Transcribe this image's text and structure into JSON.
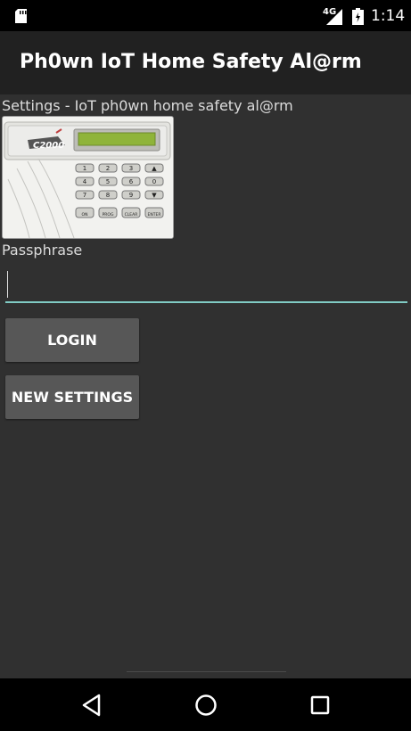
{
  "status_bar": {
    "network": "4G",
    "time": "1:14",
    "icons": [
      "sd-card-icon",
      "signal-icon",
      "battery-icon"
    ]
  },
  "app_bar": {
    "title": "Ph0wn IoT Home Safety Al@rm"
  },
  "main": {
    "settings_text": "Settings - IoT ph0wn home safety al@rm",
    "keypad": {
      "brand": "C2000",
      "keys": [
        "1",
        "2",
        "3",
        "▲",
        "4",
        "5",
        "6",
        "0",
        "7",
        "8",
        "9",
        "▼",
        "ON",
        "PROG",
        "CLEAR",
        "ENTER"
      ]
    },
    "passphrase_label": "Passphrase",
    "passphrase_value": "",
    "login_button": "LOGIN",
    "new_settings_button": "NEW SETTINGS"
  },
  "nav_bar": {
    "buttons": [
      "back-icon",
      "home-icon",
      "recents-icon"
    ]
  },
  "colors": {
    "background": "#303030",
    "app_bar": "#212121",
    "accent": "#80cbc4",
    "button": "#575757"
  }
}
